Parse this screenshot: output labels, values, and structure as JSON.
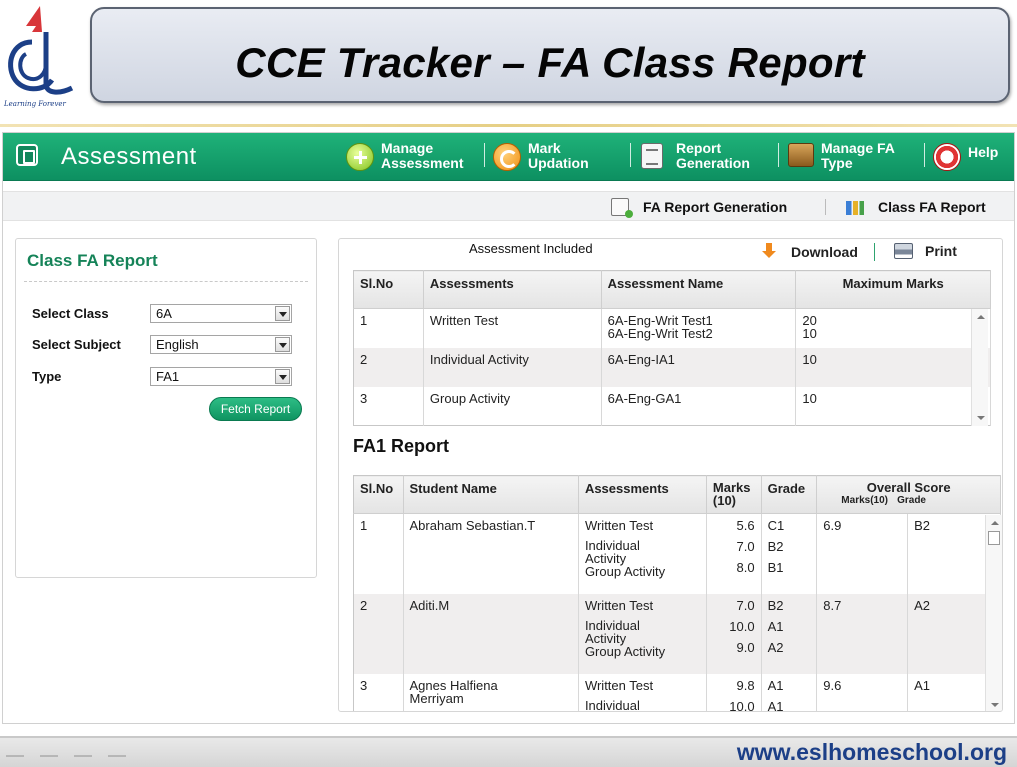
{
  "slide": {
    "title": "CCE Tracker – FA Class Report",
    "logo_tagline": "Learning Forever",
    "footer_url": "www.eslhomeschool.org"
  },
  "app": {
    "title": "Assessment",
    "nav": [
      {
        "line1": "Manage",
        "line2": "Assessment",
        "icon": "add-circle-icon"
      },
      {
        "line1": "Mark",
        "line2": "Updation",
        "icon": "refresh-icon"
      },
      {
        "line1": "Report",
        "line2": "Generation",
        "icon": "report-document-icon"
      },
      {
        "line1": "Manage FA",
        "line2": "Type",
        "icon": "box-icon"
      },
      {
        "line1": "Help",
        "line2": "",
        "icon": "lifebuoy-icon"
      }
    ],
    "subnav": [
      {
        "label": "FA Report Generation",
        "icon": "report-generation-icon"
      },
      {
        "label": "Class FA Report",
        "icon": "bar-chart-icon"
      }
    ],
    "colors": {
      "topbar": "#10a06a",
      "accent_text": "#158358"
    }
  },
  "filter_panel": {
    "heading": "Class FA Report",
    "fields": [
      {
        "label": "Select Class",
        "value": "6A"
      },
      {
        "label": "Select Subject",
        "value": "English"
      },
      {
        "label": "Type",
        "value": "FA1"
      }
    ],
    "fetch_label": "Fetch Report"
  },
  "report_panel": {
    "included_label": "Assessment Included",
    "download_label": "Download",
    "print_label": "Print",
    "assessments_table": {
      "headers": [
        "Sl.No",
        "Assessments",
        "Assessment Name",
        "Maximum Marks"
      ],
      "rows": [
        {
          "sl": "1",
          "assessment": "Written Test",
          "names": [
            "6A-Eng-Writ Test1",
            "6A-Eng-Writ Test2"
          ],
          "max": [
            "20",
            "10"
          ]
        },
        {
          "sl": "2",
          "assessment": "Individual Activity",
          "names": [
            "6A-Eng-IA1"
          ],
          "max": [
            "10"
          ]
        },
        {
          "sl": "3",
          "assessment": "Group Activity",
          "names": [
            "6A-Eng-GA1"
          ],
          "max": [
            "10"
          ]
        }
      ]
    },
    "fa_title": "FA1 Report",
    "fa_table": {
      "headers": {
        "sl": "Sl.No",
        "student": "Student Name",
        "assessments": "Assessments",
        "marks_line1": "Marks",
        "marks_line2": "(10)",
        "grade": "Grade",
        "overall": "Overall Score",
        "overall_marks": "Marks(10)",
        "overall_grade": "Grade"
      },
      "rows": [
        {
          "sl": "1",
          "name": [
            "Abraham Sebastian.T"
          ],
          "assessments": [
            "Written Test",
            "Individual",
            "Activity",
            "Group Activity"
          ],
          "marks": [
            "5.6",
            "7.0",
            "8.0"
          ],
          "grades": [
            "C1",
            "B2",
            "B1"
          ],
          "overall_marks": "6.9",
          "overall_grade": "B2"
        },
        {
          "sl": "2",
          "name": [
            "Aditi.M"
          ],
          "assessments": [
            "Written Test",
            "Individual",
            "Activity",
            "Group Activity"
          ],
          "marks": [
            "7.0",
            "10.0",
            "9.0"
          ],
          "grades": [
            "B2",
            "A1",
            "A2"
          ],
          "overall_marks": "8.7",
          "overall_grade": "A2"
        },
        {
          "sl": "3",
          "name": [
            "Agnes Halfiena",
            "Merriyam"
          ],
          "assessments": [
            "Written Test",
            "Individual"
          ],
          "marks": [
            "9.8",
            "10.0"
          ],
          "grades": [
            "A1",
            "A1"
          ],
          "overall_marks": "9.6",
          "overall_grade": "A1"
        }
      ]
    }
  }
}
